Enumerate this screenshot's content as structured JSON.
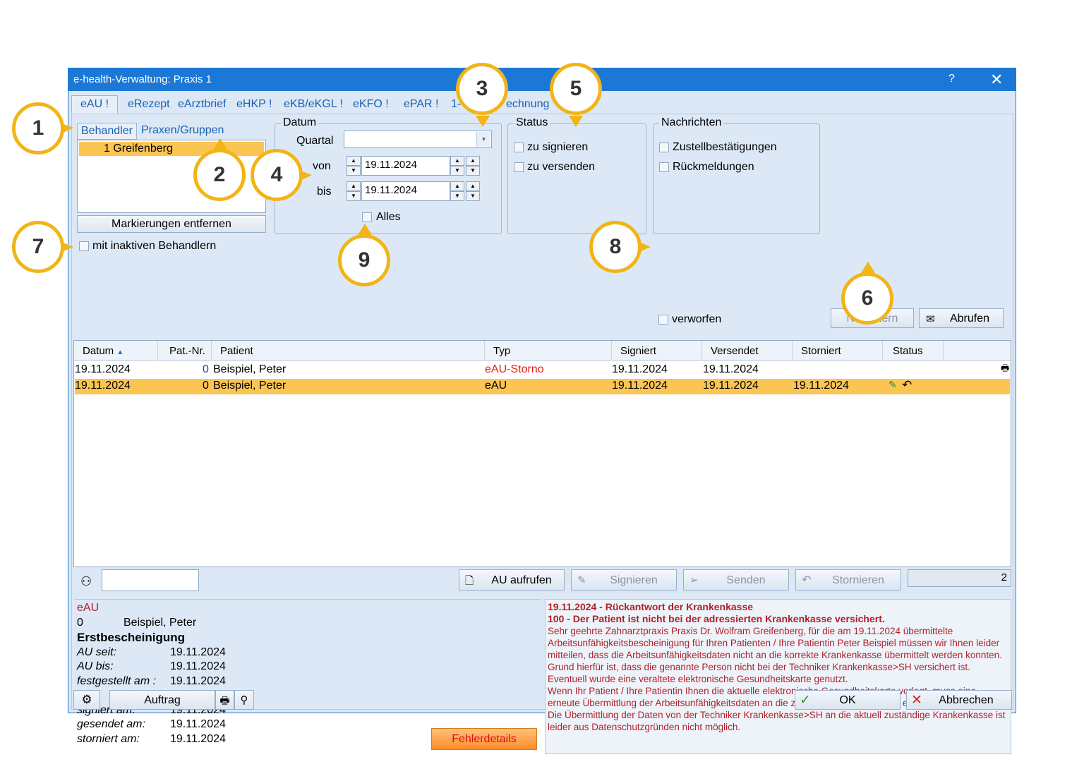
{
  "window": {
    "title": "e-health-Verwaltung: Praxis 1",
    "help": "?",
    "close": "✕"
  },
  "tabs": [
    "eAU !",
    "eRezept",
    "eArztbrief",
    "eHKP !",
    "eKB/eKGL !",
    "eKFO !",
    "ePAR !",
    "1-",
    "echnung"
  ],
  "behandler": {
    "tab_behandler": "Behandler",
    "tab_praxen": "Praxen/Gruppen",
    "items": [
      "1 Greifenberg"
    ],
    "remove_button": "Markierungen entfernen",
    "inactive_label": "mit inaktiven Behandlern"
  },
  "datum": {
    "legend": "Datum",
    "quartal_label": "Quartal",
    "quartal_value": "",
    "von_label": "von",
    "von_value": "19.11.2024",
    "bis_label": "bis",
    "bis_value": "19.11.2024",
    "alles_label": "Alles"
  },
  "status": {
    "legend": "Status",
    "sign_label": "zu signieren",
    "send_label": "zu versenden"
  },
  "nachrichten": {
    "legend": "Nachrichten",
    "zustell_label": "Zustellbestätigungen",
    "rueck_label": "Rückmeldungen"
  },
  "verworfen_label": "verworfen",
  "buttons": {
    "neu_filtern": "Neu filtern",
    "abrufen": "Abrufen"
  },
  "table": {
    "columns": [
      "Datum",
      "Pat.-Nr.",
      "Patient",
      "Typ",
      "Signiert",
      "Versendet",
      "Storniert",
      "Status"
    ],
    "rows": [
      {
        "datum": "19.11.2024",
        "patnr": "0",
        "patient": "Beispiel, Peter",
        "typ": "eAU-Storno",
        "signiert": "19.11.2024",
        "versendet": "19.11.2024",
        "storniert": ""
      },
      {
        "datum": "19.11.2024",
        "patnr": "0",
        "patient": "Beispiel, Peter",
        "typ": "eAU",
        "signiert": "19.11.2024",
        "versendet": "19.11.2024",
        "storniert": "19.11.2024"
      }
    ]
  },
  "actions": {
    "au_aufrufen": "AU aufrufen",
    "signieren": "Signieren",
    "senden": "Senden",
    "stornieren": "Stornieren",
    "count": "2"
  },
  "detail": {
    "type": "eAU",
    "patnr": "0",
    "patient": "Beispiel, Peter",
    "heading": "Erstbescheinigung",
    "au_seit_label": "AU seit:",
    "au_seit": "19.11.2024",
    "au_bis_label": "AU bis:",
    "au_bis": "19.11.2024",
    "festgestellt_label": "festgestellt am :",
    "festgestellt": "19.11.2024",
    "signiert_label": "signiert am:",
    "signiert": "19.11.2024",
    "gesendet_label": "gesendet am:",
    "gesendet": "19.11.2024",
    "storniert_label": "storniert am:",
    "storniert": "19.11.2024",
    "fehler_button": "Fehlerdetails"
  },
  "message": {
    "line1": "19.11.2024 - Rückantwort der Krankenkasse",
    "line2": "100 - Der Patient ist nicht bei der adressierten Krankenkasse versichert.",
    "body": [
      "Sehr geehrte Zahnarztpraxis Praxis Dr. Wolfram Greifenberg, für die am 19.11.2024 übermittelte",
      "Arbeitsunfähigkeitsbescheinigung für Ihren Patienten / Ihre Patientin Peter Beispiel müssen wir Ihnen leider",
      "mitteilen, dass die Arbeitsunfähigkeitsdaten nicht an die korrekte Krankenkasse übermittelt werden konnten.",
      "Grund hierfür ist, dass die genannte Person nicht bei der Techniker Krankenkasse>SH versichert ist.",
      "Eventuell wurde eine veraltete elektronische Gesundheitskarte genutzt.",
      "Wenn Ihr Patient / Ihre Patientin Ihnen die aktuelle elektronische Gesundheitskarte vorlegt, muss eine",
      "erneute Übermittlung der Arbeitsunfähigkeitsdaten an die zuständige Krankenkasse erfolgen.",
      "Die Übermittlung der Daten von der Techniker Krankenkasse>SH an die aktuell zuständige Krankenkasse ist",
      "leider aus Datenschutzgründen nicht möglich."
    ]
  },
  "footer": {
    "auftrag": "Auftrag",
    "ok": "OK",
    "abbrechen": "Abbrechen"
  },
  "callouts": [
    "1",
    "2",
    "3",
    "4",
    "5",
    "6",
    "7",
    "8",
    "9"
  ],
  "colors": {
    "titlebar": "#1c78d6",
    "selection": "#fbc553",
    "callout_ring": "#f2b416",
    "storno_red": "#e0201a",
    "message_red": "#b0202a"
  }
}
